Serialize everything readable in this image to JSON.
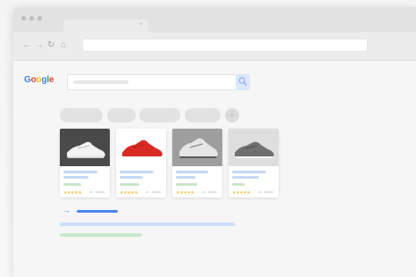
{
  "browser": {
    "tab_close": "×",
    "nav": {
      "back": "←",
      "forward": "→",
      "reload": "↻",
      "home": "⌂"
    }
  },
  "page": {
    "logo_letters": [
      "G",
      "o",
      "o",
      "g",
      "l",
      "e"
    ],
    "logo_colors": [
      "#4285f4",
      "#ea4335",
      "#fbbc05",
      "#4285f4",
      "#34a853",
      "#ea4335"
    ],
    "chip_plus": "+",
    "more_arrow": "→",
    "products": [
      {
        "image": "white-sneaker-on-dark-background",
        "stars": "★★★★★"
      },
      {
        "image": "red-sneaker-on-white-background",
        "stars": "★★★★★"
      },
      {
        "image": "grey-white-sneaker-on-grey-background",
        "stars": "★★★★★"
      },
      {
        "image": "grey-sneaker-on-light-background",
        "stars": "★★★★★"
      }
    ]
  },
  "colors": {
    "accent": "#4d86f0",
    "link_light": "#c5d8f7",
    "price_green": "#c9e6c9",
    "star": "#f4c545"
  }
}
